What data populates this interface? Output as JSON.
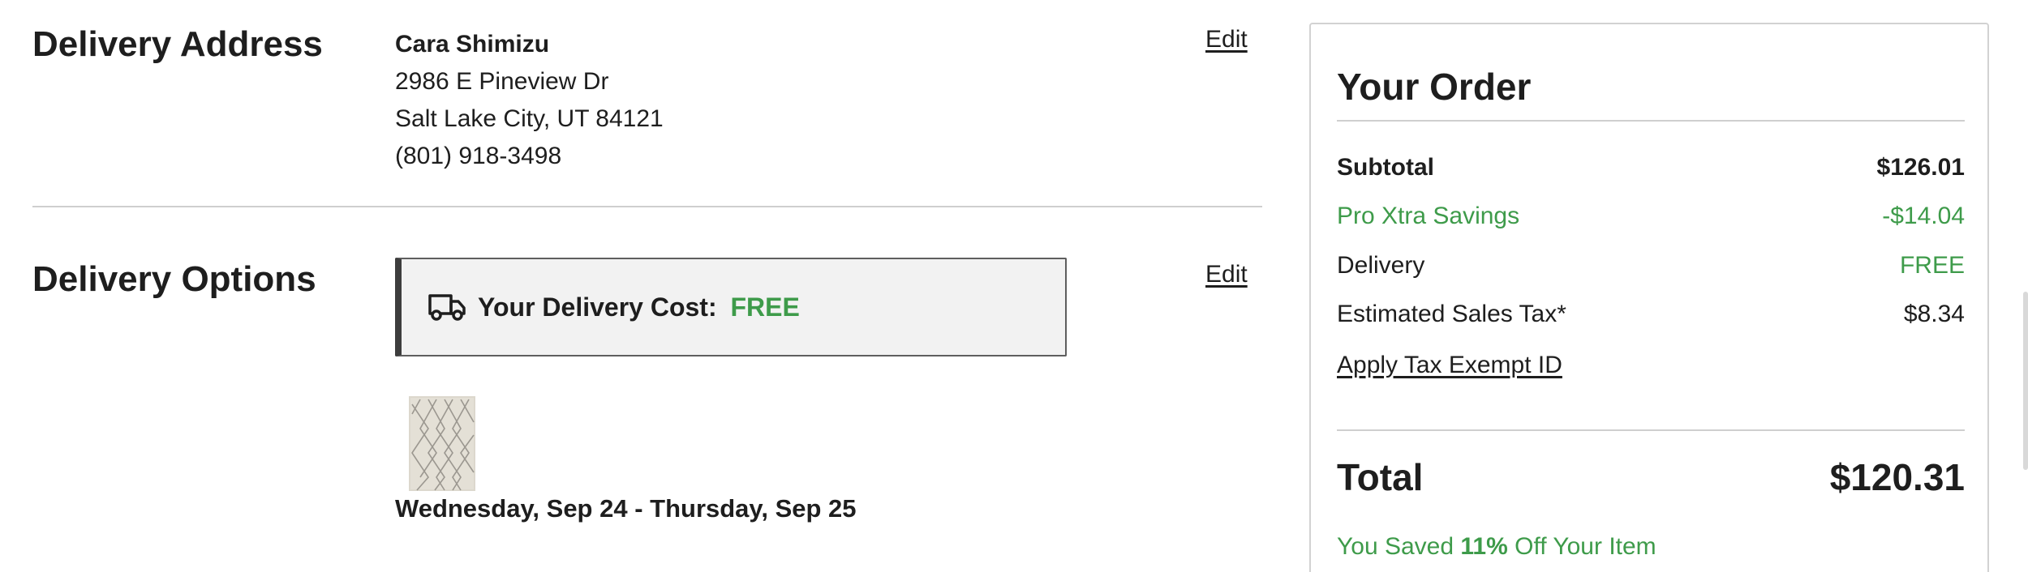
{
  "delivery_address": {
    "title": "Delivery Address",
    "edit_label": "Edit",
    "name": "Cara Shimizu",
    "street": "2986 E Pineview Dr",
    "city_state_zip": "Salt Lake City, UT 84121",
    "phone": "(801) 918-3498"
  },
  "delivery_options": {
    "title": "Delivery Options",
    "edit_label": "Edit",
    "cost_label": "Your Delivery Cost:",
    "cost_value": "FREE",
    "truck_icon": "truck-icon",
    "product_image": "rug-thumbnail",
    "delivery_window": "Wednesday, Sep 24 - Thursday, Sep 25"
  },
  "order": {
    "title": "Your Order",
    "subtotal_label": "Subtotal",
    "subtotal_value": "$126.01",
    "savings_label": "Pro Xtra Savings",
    "savings_value": "-$14.04",
    "delivery_label": "Delivery",
    "delivery_value": "FREE",
    "tax_label": "Estimated Sales Tax*",
    "tax_value": "$8.34",
    "tax_exempt_link": "Apply Tax Exempt ID",
    "total_label": "Total",
    "total_value": "$120.31",
    "saved_prefix": "You Saved",
    "saved_percent": "11%",
    "saved_suffix": "Off Your Item"
  },
  "colors": {
    "accent_green": "#3e9b4a",
    "text": "#1e1e1e",
    "divider": "#cfcfcf"
  }
}
